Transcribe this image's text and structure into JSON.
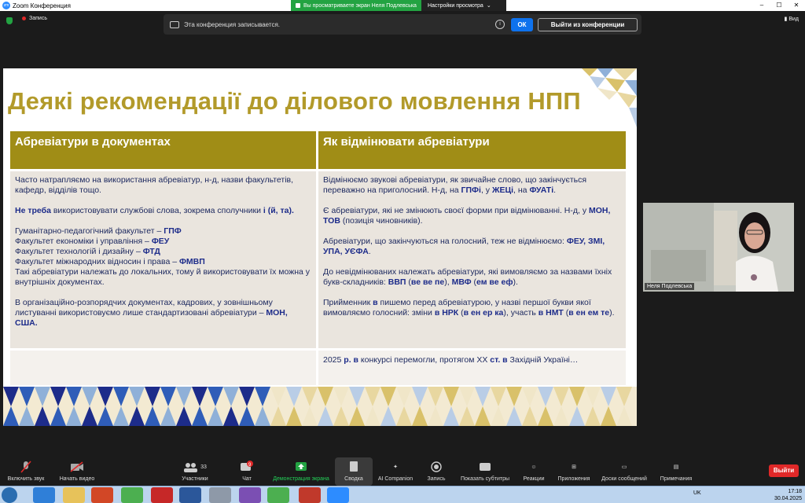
{
  "window": {
    "title": "Zoom Конференция",
    "app_icon_text": "zm"
  },
  "view_banner": {
    "viewing": "Вы просматриваете экран Неля Подлевська",
    "options": "Настройки просмотра"
  },
  "recording": {
    "label": "Запись"
  },
  "view_button": {
    "label": "Вид"
  },
  "notice": {
    "text": "Эта конференция записывается.",
    "ok": "ОК",
    "exit": "Выйти из конференции"
  },
  "slide": {
    "heading": "Деякі рекомендації до ділового мовлення НПП",
    "col1_header": "Абревіатури в документах",
    "col2_header": "Як відмінювати абревіатури",
    "col1": {
      "p1": "Часто натрапляємо на використання абревіатур, н-д, назви факультетів, кафедр, відділів тощо.",
      "p2_bold": "Не треба",
      "p2_rest": " використовувати службові слова, зокрема сполучники ",
      "p2_bold2": "і (й, та).",
      "l1": "Гуманітарно-педагогічний факультет – ",
      "l1b": "ГПФ",
      "l2": "Факультет економіки і управління – ",
      "l2b": "ФЕУ",
      "l3": "Факультет технологій і дизайну – ",
      "l3b": "ФТД",
      "l4": "Факультет міжнародних відносин і права – ",
      "l4b": "ФМВП",
      "l5": "Такі абревіатури належать до локальних, тому й використовувати їх можна у внутрішніх документах.",
      "p4": "В організаційно-розпорядчих документах, кадрових, у зовнішньому листуванні використовуємо лише стандартизовані абревіатури – ",
      "p4b": "МОН, США."
    },
    "col2": {
      "p1a": "Відмінюємо звукові абревіатури, як звичайне слово, що закінчується переважно на приголосний. Н-д, на ",
      "p1b": "ГПФі",
      "p1c": ", у ",
      "p1d": "ЖЕЦі",
      "p1e": ", на ",
      "p1f": "ФУАТі",
      "p1g": ".",
      "p2a": "Є абревіатури, які не змінюють своєї форми при відмінюванні. Н-д, у ",
      "p2b": "МОН, ТОВ",
      "p2c": " (позиція чиновників).",
      "p3a": "Абревіатури, що закінчуються на голосний, теж не відмінюємо: ",
      "p3b": "ФЕУ, ЗМІ, УПА, УЄФА",
      "p3c": ".",
      "p4a": "До невідмінюваних належать абревіатури, які вимовляємо за назвами їхніх букв-складників: ",
      "p4b": "ВВП",
      "p4c": " (",
      "p4d": "ве ве пе",
      "p4e": "), ",
      "p4f": "МВФ",
      "p4g": " (",
      "p4h": "ем ве еф",
      "p4i": ").",
      "p5a": "Прийменник ",
      "p5b": "в",
      "p5c": " пишемо перед абревіатурою, у назві першої букви якої вимовляємо голосний: зміни ",
      "p5d": "в НРК",
      "p5e": " (",
      "p5f": "в ен ер ка",
      "p5g": "), участь ",
      "p5h": "в НМТ",
      "p5i": " (",
      "p5j": "в ен ем те",
      "p5k": ").",
      "p6a": "2025 ",
      "p6b": "р. в",
      "p6c": " конкурсі перемогли, протягом ХХ ",
      "p6d": "ст. в",
      "p6e": " Західній Україні…"
    }
  },
  "video": {
    "name": "Неля Подлевська"
  },
  "toolbar": {
    "mute": "Включить звук",
    "video": "Начать видео",
    "participants": "Участники",
    "participants_count": "33",
    "chat": "Чат",
    "chat_badge": "9",
    "share": "Демонстрация экрана",
    "summary": "Сводка",
    "ai": "AI Companion",
    "record": "Запись",
    "captions": "Показать субтитры",
    "reactions": "Реакции",
    "apps": "Приложения",
    "whiteboards": "Доски сообщений",
    "notes": "Примечания",
    "end": "Выйти"
  },
  "taskbar": {
    "lang": "UK",
    "time": "17:18",
    "date": "30.04.2025"
  },
  "colors": {
    "accent_blue": "#0e72ed",
    "share_green": "#23a342",
    "end_red": "#e02828",
    "slide_gold": "#a08d16",
    "slide_text": "#1e2a60"
  }
}
